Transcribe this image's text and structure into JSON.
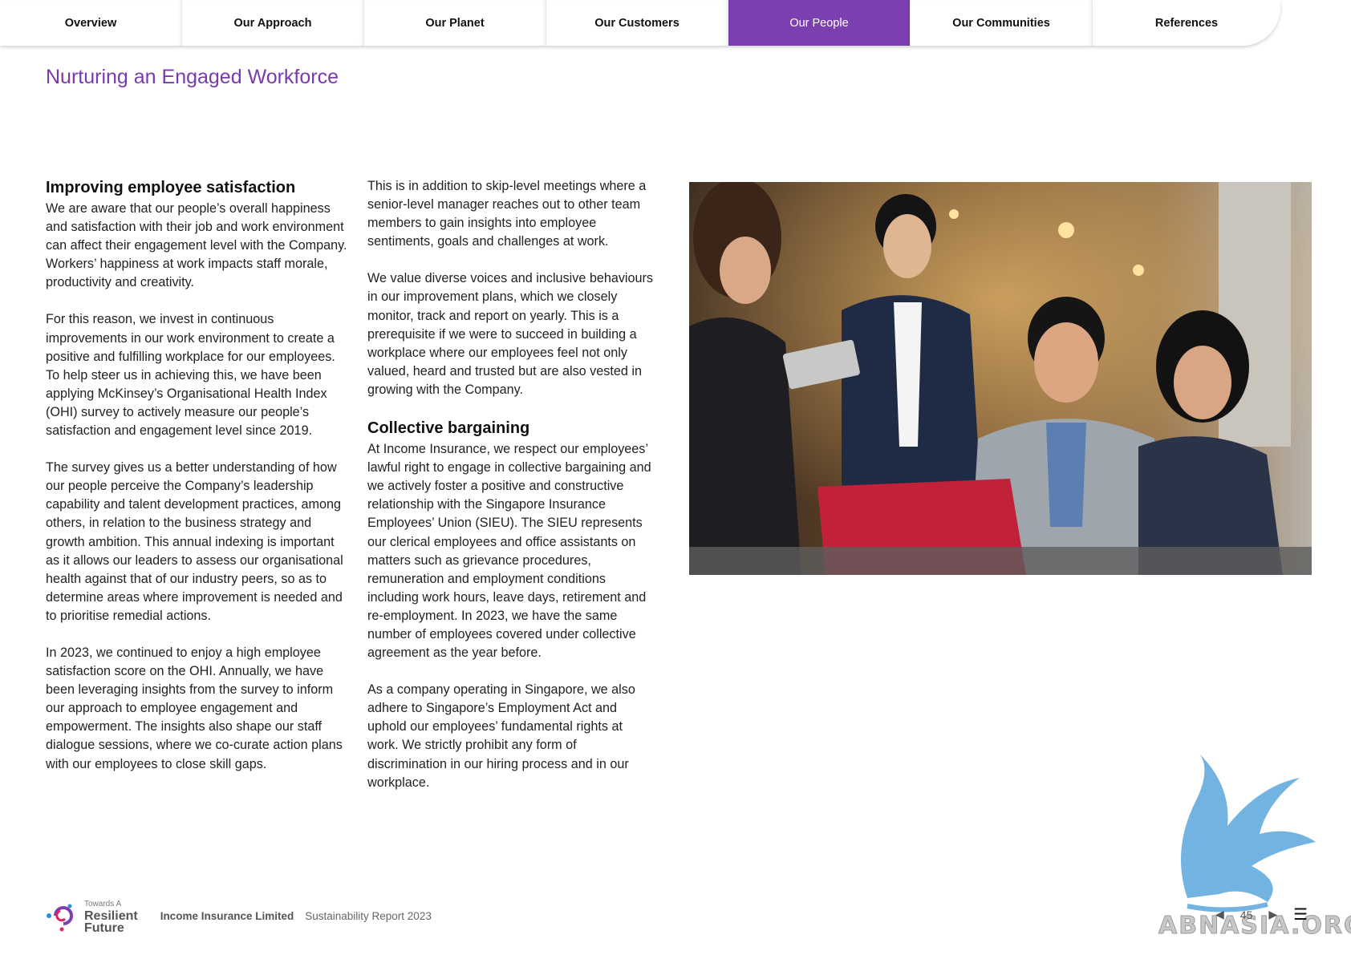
{
  "nav": {
    "tabs": [
      {
        "label": "Overview"
      },
      {
        "label": "Our Approach"
      },
      {
        "label": "Our Planet"
      },
      {
        "label": "Our Customers"
      },
      {
        "label": "Our People",
        "active": true
      },
      {
        "label": "Our Communities"
      },
      {
        "label": "References"
      }
    ],
    "active_color": "#7b3fb0"
  },
  "page": {
    "title": "Nurturing an Engaged Workforce",
    "title_color": "#7a3aaa"
  },
  "col1": {
    "heading": "Improving employee satisfaction",
    "p1": "We are aware that our people’s overall happiness and satisfaction with their job and work environment can affect their engagement level with the Company. Workers’ happiness at work impacts staff morale, productivity and creativity.",
    "p2": "For this reason, we invest in continuous improvements in our work environment to create a positive and fulfilling workplace for our employees. To help steer us in achieving this, we have been applying McKinsey’s Organisational Health Index (OHI) survey to actively measure our people’s satisfaction and engagement level since 2019.",
    "p3": "The survey gives us a better understanding of how our people perceive the Company’s leadership capability and talent development practices, among others, in relation to the business strategy and growth ambition. This annual indexing is important as it allows our leaders to assess our organisational health against that of our industry peers, so as to determine areas where improvement is needed and to prioritise remedial actions.",
    "p4": "In 2023, we continued to enjoy a high employee satisfaction score on the OHI. Annually, we have been leveraging insights from the survey to inform our approach to employee engagement and empowerment. The insights also shape our staff dialogue sessions, where we co-curate action plans with our employees to close skill gaps."
  },
  "col2": {
    "p1": "This is in addition to skip-level meetings where a senior-level manager reaches out to other team members to gain insights into employee sentiments, goals and challenges at work.",
    "p2": "We value diverse voices and inclusive behaviours in our improvement plans, which we closely monitor, track and report on yearly. This is a prerequisite if we were to succeed in building a workplace where our employees feel not only valued, heard and trusted but are also vested in growing with the Company.",
    "heading": "Collective bargaining",
    "p3": "At Income Insurance, we respect our employees’ lawful right to engage in collective bargaining and we actively foster a positive and constructive relationship with the Singapore Insurance Employees’ Union (SIEU). The SIEU represents our clerical employees and office assistants on matters such as grievance procedures, remuneration and employment conditions including work hours, leave days, retirement and re-employment. In 2023, we have the same number of employees covered under collective agreement as the year before.",
    "p4": "As a company operating in Singapore, we also adhere to Singapore’s Employment Act and uphold our employees’ fundamental rights at work. We strictly prohibit any form of discrimination in our hiring process and in our workplace."
  },
  "footer": {
    "logo_small": "Towards A",
    "logo_line1": "Resilient",
    "logo_line2": "Future",
    "company": "Income Insurance Limited",
    "report": "Sustainability Report 2023",
    "page_number": "45"
  },
  "watermark": {
    "text": "ABNASIA.ORG"
  },
  "icons": {
    "prev": "prev-arrow-icon",
    "next": "next-arrow-icon",
    "menu": "menu-icon"
  }
}
